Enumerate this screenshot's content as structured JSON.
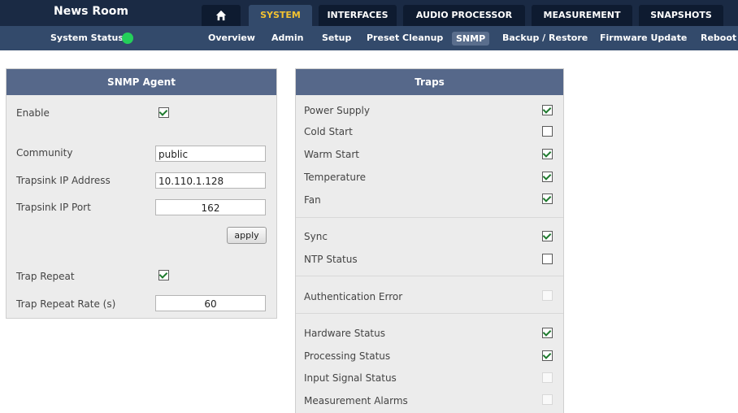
{
  "app": {
    "title": "News Room"
  },
  "tabs": [
    {
      "label": "",
      "icon": "home-icon"
    },
    {
      "label": "SYSTEM"
    },
    {
      "label": "INTERFACES"
    },
    {
      "label": "AUDIO PROCESSOR"
    },
    {
      "label": "MEASUREMENT"
    },
    {
      "label": "SNAPSHOTS"
    }
  ],
  "subnav": {
    "status_label": "System Status",
    "status_color": "#24d05a",
    "items": [
      "Overview",
      "Admin",
      "Setup",
      "Preset Cleanup",
      "SNMP",
      "Backup / Restore",
      "Firmware Update",
      "Reboot"
    ]
  },
  "snmp_agent": {
    "title": "SNMP Agent",
    "enable_label": "Enable",
    "enable_checked": true,
    "community_label": "Community",
    "community_value": "public",
    "trapsink_ip_label": "Trapsink IP Address",
    "trapsink_ip_value": "10.110.1.128",
    "trapsink_port_label": "Trapsink IP Port",
    "trapsink_port_value": "162",
    "apply_label": "apply",
    "trap_repeat_label": "Trap Repeat",
    "trap_repeat_checked": true,
    "trap_repeat_rate_label": "Trap Repeat Rate (s)",
    "trap_repeat_rate_value": "60"
  },
  "traps": {
    "title": "Traps",
    "items": [
      {
        "label": "Power Supply",
        "checked": true
      },
      {
        "label": "Cold Start",
        "checked": false
      },
      {
        "label": "Warm Start",
        "checked": true
      },
      {
        "label": "Temperature",
        "checked": true
      },
      {
        "label": "Fan",
        "checked": true
      },
      {
        "label": "Sync",
        "checked": true
      },
      {
        "label": "NTP Status",
        "checked": false
      },
      {
        "label": "Authentication Error",
        "checked": false,
        "disabled": true
      },
      {
        "label": "Hardware Status",
        "checked": true
      },
      {
        "label": "Processing Status",
        "checked": true
      },
      {
        "label": "Input Signal Status",
        "checked": false,
        "disabled": true
      },
      {
        "label": "Measurement Alarms",
        "checked": false,
        "disabled": true
      }
    ]
  }
}
